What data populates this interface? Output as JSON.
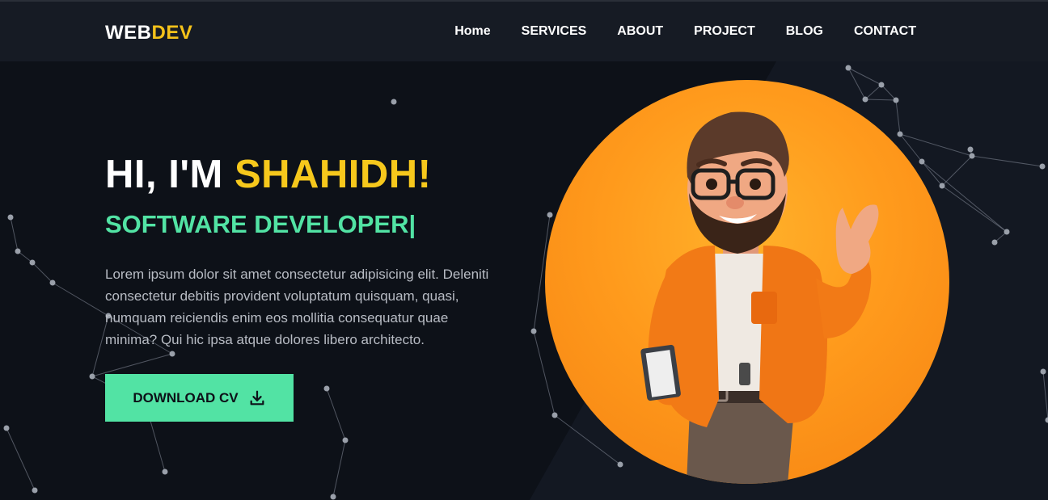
{
  "brand": {
    "part1": "WEB",
    "part2": "DEV"
  },
  "nav": {
    "items": [
      "Home",
      "SERVICES",
      "ABOUT",
      "PROJECT",
      "BLOG",
      "CONTACT"
    ]
  },
  "hero": {
    "greeting": "HI, I'M ",
    "name": "SHAHIDH!",
    "role": "SOFTWARE DEVELOPER",
    "caret": "|",
    "description": "Lorem ipsum dolor sit amet consectetur adipisicing elit. Deleniti consectetur debitis provident voluptatum quisquam, quasi, numquam reiciendis enim eos mollitia consequatur quae minima? Qui hic ipsa atque dolores libero architecto.",
    "cta_label": "DOWNLOAD CV"
  },
  "icons": {
    "cta_icon": "download-icon",
    "avatar": "developer-avatar-illustration"
  },
  "colors": {
    "background": "#0d1118",
    "navbar": "#161b24",
    "accent_yellow": "#f6c81c",
    "accent_green": "#52e3a4",
    "circle_orange": "#ff9a1c"
  }
}
